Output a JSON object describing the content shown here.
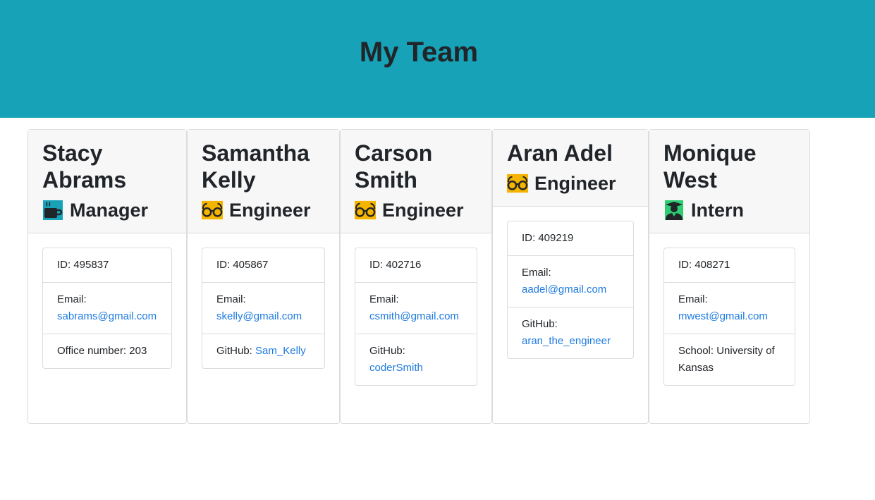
{
  "header": {
    "title": "My Team"
  },
  "team": [
    {
      "name_line1": "Stacy",
      "name_line2": "Abrams",
      "role": "Manager",
      "icon": "coffee-icon",
      "id_label": "ID: 495837",
      "email_label": "Email:",
      "email": "sabrams@gmail.com",
      "extra_label": "Office number: 203"
    },
    {
      "name_line1": "Samantha",
      "name_line2": "Kelly",
      "role": "Engineer",
      "icon": "glasses-icon",
      "id_label": "ID: 405867",
      "email_label": "Email:",
      "email": "skelly@gmail.com",
      "github_label": "GitHub:",
      "github": "Sam_Kelly"
    },
    {
      "name_line1": "Carson",
      "name_line2": "Smith",
      "role": "Engineer",
      "icon": "glasses-icon",
      "id_label": "ID: 402716",
      "email_label": "Email:",
      "email": "csmith@gmail.com",
      "github_label": "GitHub:",
      "github": "coderSmith"
    },
    {
      "name_line1": "Aran Adel",
      "role": "Engineer",
      "icon": "glasses-icon",
      "id_label": "ID: 409219",
      "email_label": "Email:",
      "email": "aadel@gmail.com",
      "github_label": "GitHub:",
      "github": "aran_the_engineer"
    },
    {
      "name_line1": "Monique",
      "name_line2": "West",
      "role": "Intern",
      "icon": "user-graduate-icon",
      "id_label": "ID: 408271",
      "email_label": "Email:",
      "email": "mwest@gmail.com",
      "extra_label": "School: University of Kansas"
    }
  ],
  "colors": {
    "header_bg": "#17a2b8",
    "link": "#1e7be0",
    "card_head_bg": "#f7f7f7",
    "glasses": "#f5b400",
    "coffee_bg": "#17a2b8",
    "intern_green": "#2ecc71"
  }
}
